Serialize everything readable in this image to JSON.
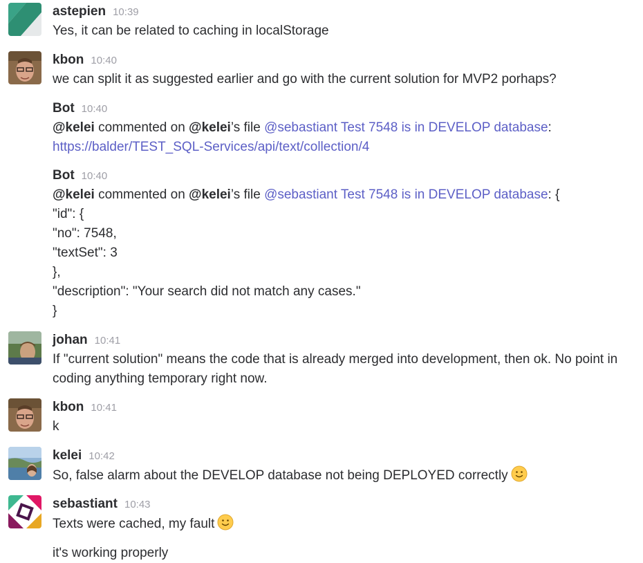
{
  "messages": [
    {
      "author": "astepien",
      "time": "10:39",
      "avatar_icon": "astepien-avatar",
      "text": "Yes, it can be related to caching in localStorage"
    },
    {
      "author": "kbon",
      "time": "10:40",
      "avatar_icon": "kbon-avatar",
      "text": "we can split it as suggested earlier and go with the current solution for MVP2 porhaps?"
    },
    {
      "author": "Bot",
      "time": "10:40",
      "mention1": "@kelei",
      "commented_on": " commented on ",
      "mention2": "@kelei",
      "file_suffix": "’s file ",
      "file_link": "@sebastiant Test 7548 is in DEVELOP database",
      "colon": ":",
      "url": "https://balder/TEST_SQL-Services/api/text/collection/4"
    },
    {
      "author": "Bot",
      "time": "10:40",
      "mention1": "@kelei",
      "commented_on": " commented on ",
      "mention2": "@kelei",
      "file_suffix": "’s file ",
      "file_link": "@sebastiant Test 7548 is in DEVELOP database",
      "after_link": ": {",
      "json_lines": [
        "\"id\": {",
        "\"no\": 7548,",
        "\"textSet\": 3",
        "},",
        "\"description\": \"Your search did not match any cases.\"",
        "}"
      ]
    },
    {
      "author": "johan",
      "time": "10:41",
      "avatar_icon": "johan-avatar",
      "text": "If \"current solution\" means the code that is already merged into development, then ok. No point in coding anything temporary right now."
    },
    {
      "author": "kbon",
      "time": "10:41",
      "avatar_icon": "kbon-avatar",
      "text": "k"
    },
    {
      "author": "kelei",
      "time": "10:42",
      "avatar_icon": "kelei-avatar",
      "text": "So, false alarm about the DEVELOP database not being DEPLOYED correctly",
      "emoji": "slightly-smiling-face-icon"
    },
    {
      "author": "sebastiant",
      "time": "10:43",
      "avatar_icon": "sebastiant-avatar",
      "text": "Texts were cached, my fault",
      "emoji": "slightly-smiling-face-icon",
      "followup": "it's working properly"
    }
  ],
  "colors": {
    "link": "#5c5fc6",
    "timestamp": "#9e9ea6",
    "text": "#2c2d30"
  }
}
